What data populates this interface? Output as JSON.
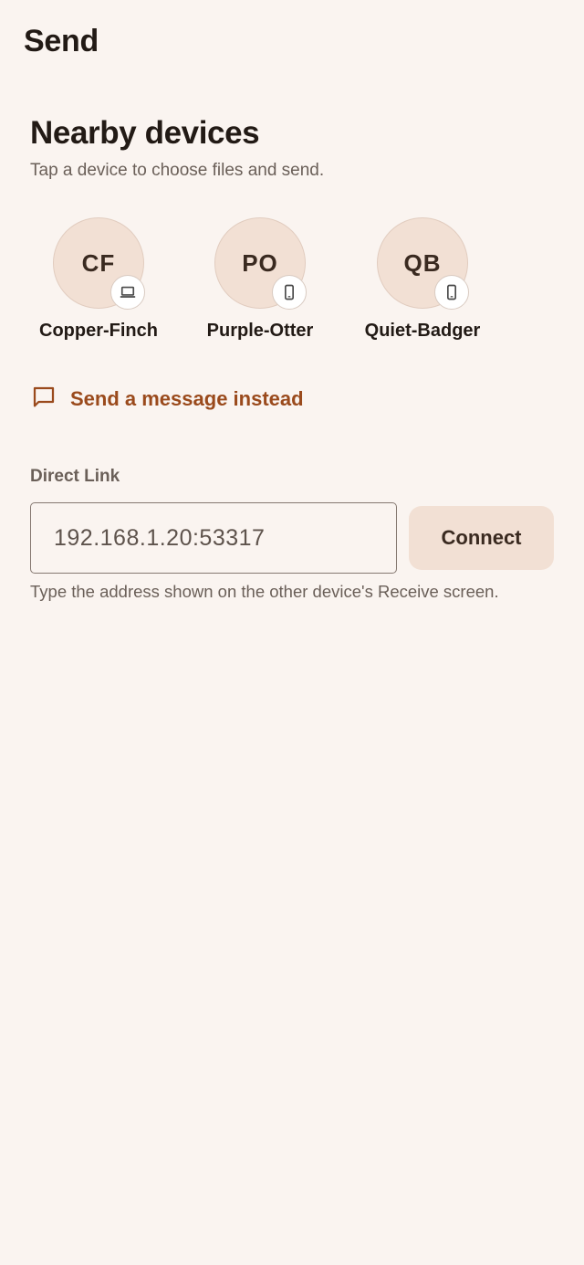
{
  "app_bar": {
    "title": "Send"
  },
  "nearby": {
    "title": "Nearby devices",
    "subtitle": "Tap a device to choose files and send.",
    "devices": [
      {
        "initials": "CF",
        "name": "Copper-Finch",
        "device_type_icon": "laptop-icon"
      },
      {
        "initials": "PO",
        "name": "Purple-Otter",
        "device_type_icon": "phone-icon"
      },
      {
        "initials": "QB",
        "name": "Quiet-Badger",
        "device_type_icon": "phone-icon"
      }
    ]
  },
  "message_action": {
    "label": "Send a message instead",
    "icon": "message-bubble-icon"
  },
  "direct_link": {
    "label": "Direct Link",
    "value": "192.168.1.20:53317",
    "connect_label": "Connect",
    "helper": "Type the address shown on the other device's Receive screen."
  },
  "colors": {
    "background": "#faf4f0",
    "avatar_fill": "#f2e0d4",
    "accent": "#9a4a1c",
    "text_primary": "#221a15",
    "text_secondary": "#6a5f58"
  }
}
